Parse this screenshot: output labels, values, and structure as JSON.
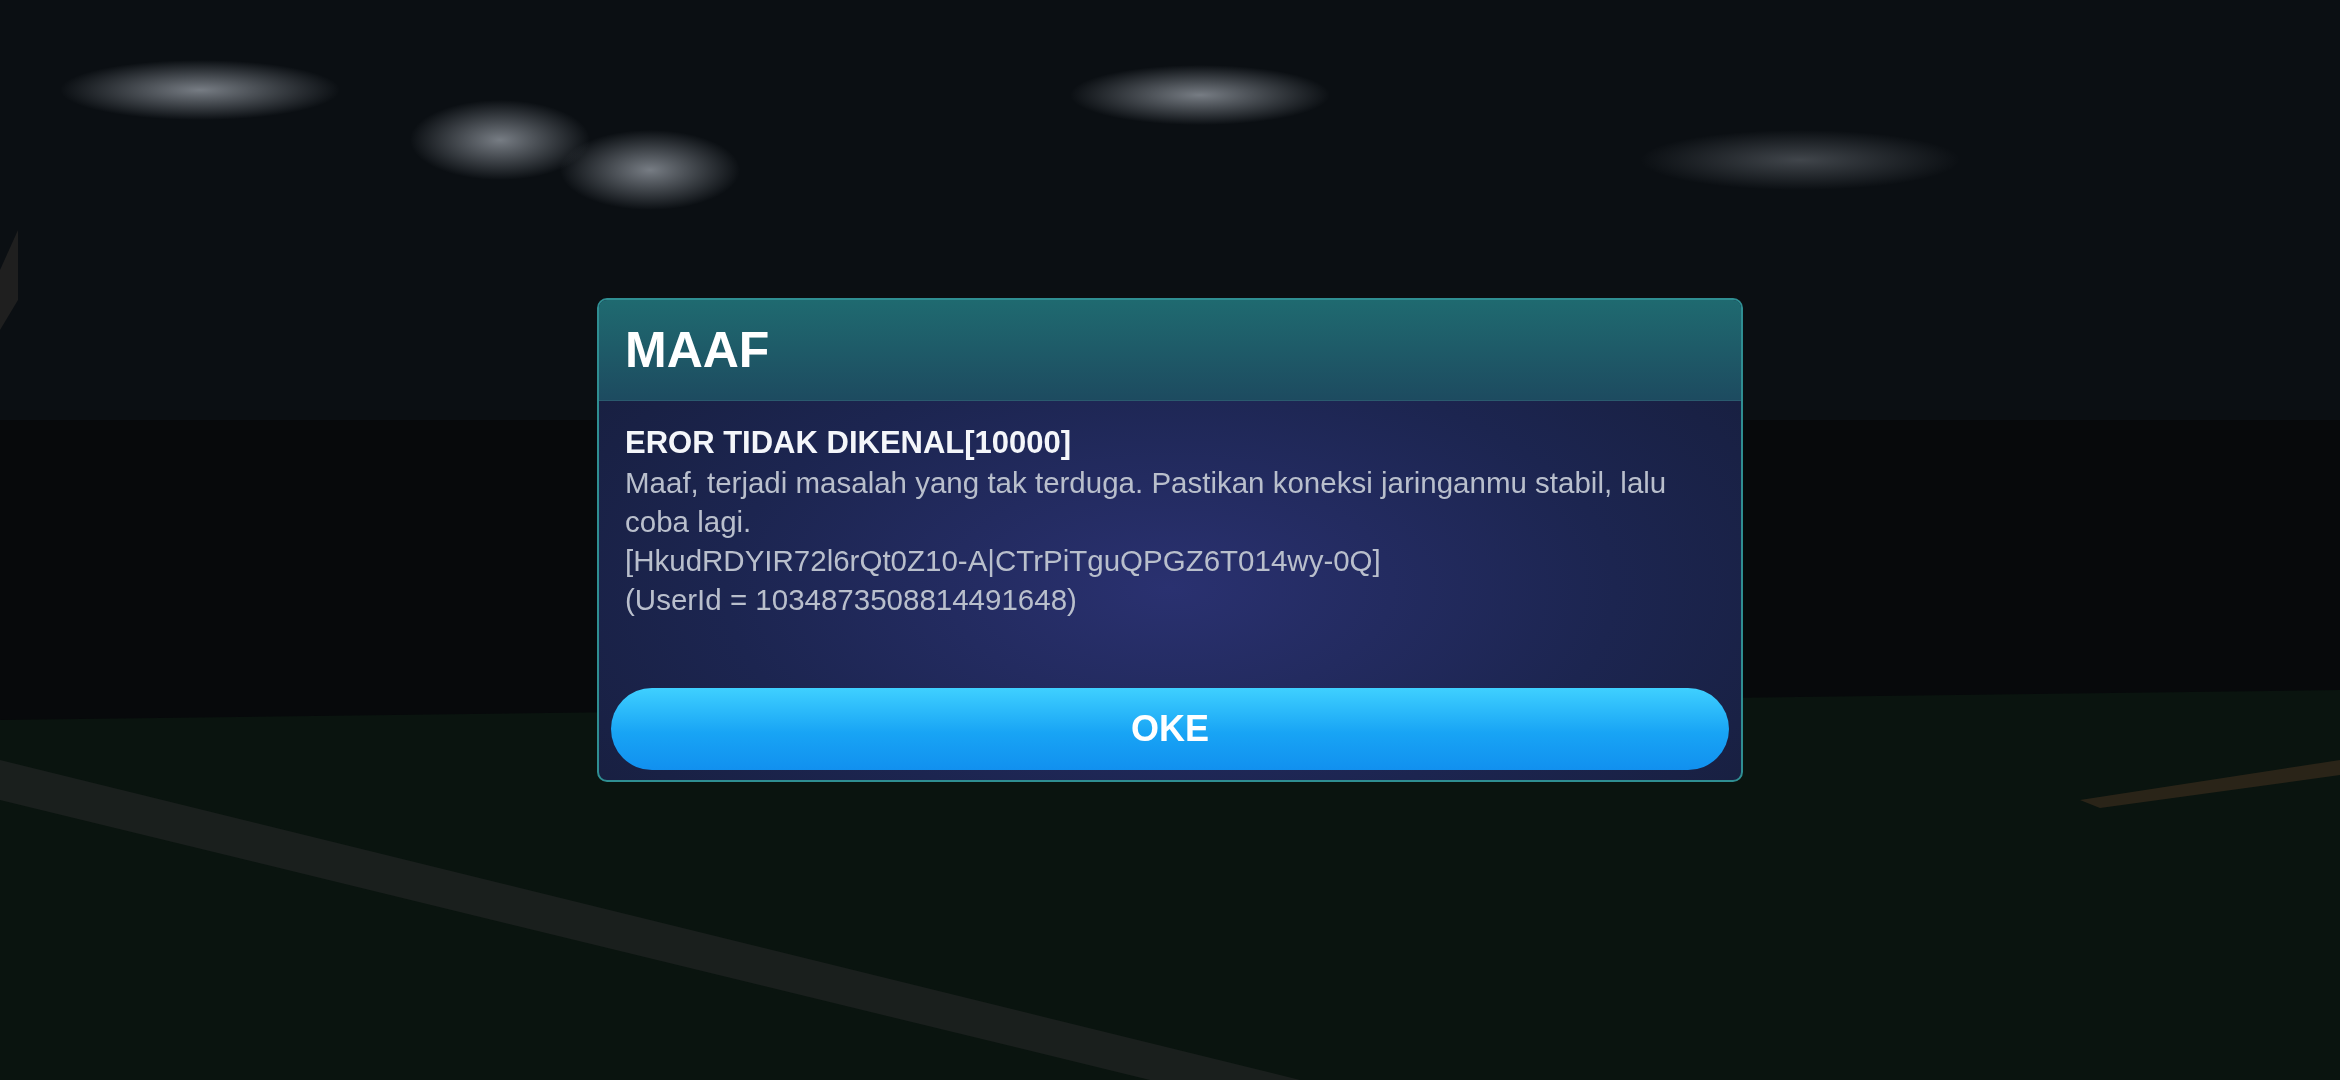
{
  "dialog": {
    "title": "MAAF",
    "heading": "EROR TIDAK DIKENAL[10000]",
    "message": "Maaf, terjadi masalah yang tak terduga. Pastikan koneksi jaringanmu stabil, lalu coba lagi.",
    "code": "[HkudRDYIR72l6rQt0Z10-A|CTrPiTguQPGZ6T014wy-0Q]",
    "user_id": "(UserId = 1034873508814491648)",
    "buttons": [
      "OKE"
    ]
  }
}
